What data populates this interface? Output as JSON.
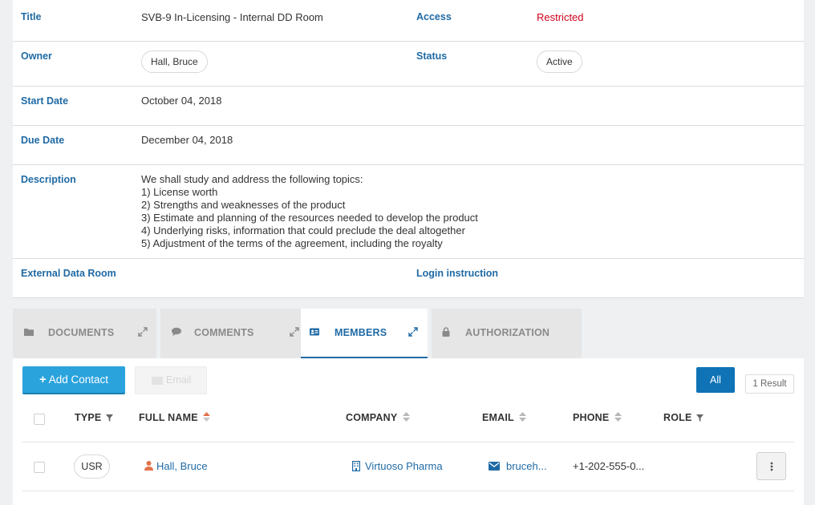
{
  "details": {
    "title_label": "Title",
    "title_value": "SVB-9 In-Licensing - Internal DD Room",
    "access_label": "Access",
    "access_value": "Restricted",
    "owner_label": "Owner",
    "owner_value": "Hall, Bruce",
    "status_label": "Status",
    "status_value": "Active",
    "start_label": "Start Date",
    "start_value": "October 04, 2018",
    "due_label": "Due Date",
    "due_value": "December 04, 2018",
    "description_label": "Description",
    "description_lines": [
      "We shall study and address the following topics:",
      "1) License worth",
      "2) Strengths and weaknesses of the product",
      "3) Estimate and planning of the resources needed to develop the product",
      "4) Underlying risks, information that could preclude the deal altogether",
      "5) Adjustment of the terms of the agreement, including the royalty"
    ],
    "external_label": "External Data Room",
    "login_label": "Login instruction"
  },
  "colors": {
    "label_blue": "#1f6aa5",
    "restricted_red": "#d0021b",
    "add_button": "#2aa3dd",
    "all_button": "#0f73b6",
    "user_icon": "#e2734a"
  },
  "tabs": [
    {
      "label": "DOCUMENTS",
      "icon": "folder-icon"
    },
    {
      "label": "COMMENTS",
      "icon": "comment-icon"
    },
    {
      "label": "MEMBERS",
      "icon": "id-card-icon",
      "active": true
    },
    {
      "label": "AUTHORIZATION",
      "icon": "lock-icon"
    }
  ],
  "toolbar": {
    "add_contact": "Add Contact",
    "email": "Email",
    "all": "All",
    "result_count": "1 Result"
  },
  "table": {
    "headers": {
      "type": "TYPE",
      "full_name": "FULL NAME",
      "company": "COMPANY",
      "email": "EMAIL",
      "phone": "PHONE",
      "role": "ROLE"
    },
    "rows": [
      {
        "type": "USR",
        "full_name": "Hall, Bruce",
        "company": "Virtuoso Pharma",
        "email": "bruceh...",
        "phone": "+1-202-555-0...",
        "role": ""
      }
    ]
  }
}
